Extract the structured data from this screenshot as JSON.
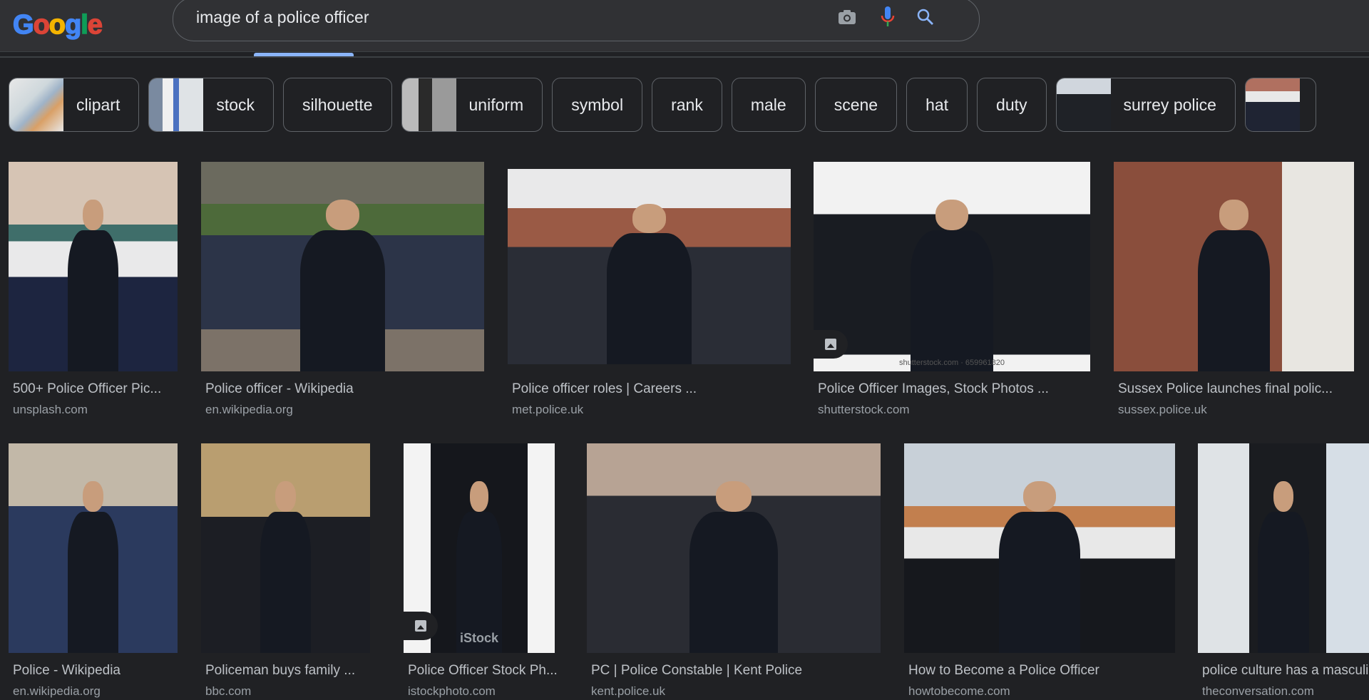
{
  "header": {
    "logo_letters": [
      {
        "char": "G",
        "color": "#4285f4"
      },
      {
        "char": "o",
        "color": "#db4437"
      },
      {
        "char": "o",
        "color": "#f4b400"
      },
      {
        "char": "g",
        "color": "#4285f4"
      },
      {
        "char": "l",
        "color": "#0f9d58"
      },
      {
        "char": "e",
        "color": "#db4437"
      }
    ],
    "search_query": "image of a police officer",
    "icons": [
      "camera-icon",
      "microphone-icon",
      "search-icon"
    ],
    "active_tab_color": "#8ab4f8"
  },
  "chips": [
    {
      "label": "clipart",
      "thumb": true
    },
    {
      "label": "stock",
      "thumb": true
    },
    {
      "label": "silhouette",
      "thumb": false
    },
    {
      "label": "uniform",
      "thumb": true
    },
    {
      "label": "symbol",
      "thumb": false
    },
    {
      "label": "rank",
      "thumb": false
    },
    {
      "label": "male",
      "thumb": false
    },
    {
      "label": "scene",
      "thumb": false
    },
    {
      "label": "hat",
      "thumb": false
    },
    {
      "label": "duty",
      "thumb": false
    },
    {
      "label": "surrey police",
      "thumb": true
    },
    {
      "label": "",
      "thumb": true
    }
  ],
  "results": [
    {
      "title": "500+ Police Officer Pic...",
      "source": "unsplash.com"
    },
    {
      "title": "Police officer - Wikipedia",
      "source": "en.wikipedia.org"
    },
    {
      "title": "Police officer roles | Careers ...",
      "source": "met.police.uk"
    },
    {
      "title": "Police Officer Images, Stock Photos ...",
      "source": "shutterstock.com",
      "watermark": "shutterstock.com · 659961820"
    },
    {
      "title": "Sussex Police launches final polic...",
      "source": "sussex.police.uk"
    },
    {
      "title": "Police - Wikipedia",
      "source": "en.wikipedia.org"
    },
    {
      "title": "Policeman buys family ...",
      "source": "bbc.com"
    },
    {
      "title": "Police Officer Stock Ph...",
      "source": "istockphoto.com",
      "watermark": "iStock"
    },
    {
      "title": "PC | Police Constable | Kent Police",
      "source": "kent.police.uk"
    },
    {
      "title": "How to Become a Police Officer",
      "source": "howtobecome.com"
    },
    {
      "title": "police culture has a masculinity...",
      "source": "theconversation.com"
    }
  ]
}
